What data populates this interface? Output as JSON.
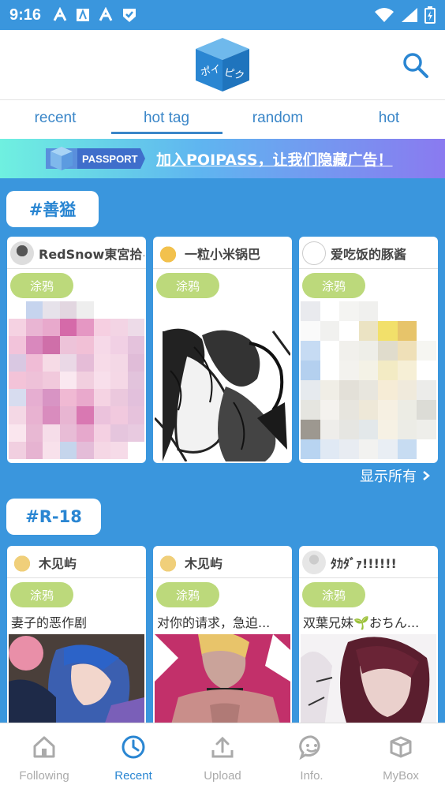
{
  "status_bar": {
    "time": "9:16"
  },
  "header": {
    "logo_text": "ポイピク"
  },
  "tabs": [
    {
      "label": "recent",
      "active": false
    },
    {
      "label": "hot tag",
      "active": true
    },
    {
      "label": "random",
      "active": false
    },
    {
      "label": "hot",
      "active": false
    }
  ],
  "banner": {
    "logo_text": "PASSPORT",
    "text": "加入POIPASS，让我们隐藏广告！"
  },
  "sections": [
    {
      "tag": "#善獈",
      "cards": [
        {
          "user": "RedSnow東宮拾る",
          "badge": "涂鸦",
          "desc": ""
        },
        {
          "user": "一粒小米锅巴",
          "badge": "涂鸦",
          "desc": ""
        },
        {
          "user": "爱吃饭的豚酱",
          "badge": "涂鸦",
          "desc": ""
        }
      ],
      "show_all": "显示所有"
    },
    {
      "tag": "#R-18",
      "cards": [
        {
          "user": "木见屿",
          "badge": "涂鸦",
          "desc": "妻子的恶作剧"
        },
        {
          "user": "木见屿",
          "badge": "涂鸦",
          "desc": "对你的请求，急迫..."
        },
        {
          "user": "ﾀｶﾀﾞｧ!!!!!!",
          "badge": "涂鸦",
          "desc": "双葉兄妹🌱おちん..."
        }
      ]
    }
  ],
  "bottom_nav": [
    {
      "label": "Following",
      "icon": "home-icon",
      "active": false
    },
    {
      "label": "Recent",
      "icon": "clock-icon",
      "active": true
    },
    {
      "label": "Upload",
      "icon": "upload-icon",
      "active": false
    },
    {
      "label": "Info.",
      "icon": "chat-icon",
      "active": false
    },
    {
      "label": "MyBox",
      "icon": "box-icon",
      "active": false
    }
  ],
  "colors": {
    "primary": "#3a96dd",
    "accent": "#2a86d2",
    "badge": "#bcd97b"
  }
}
